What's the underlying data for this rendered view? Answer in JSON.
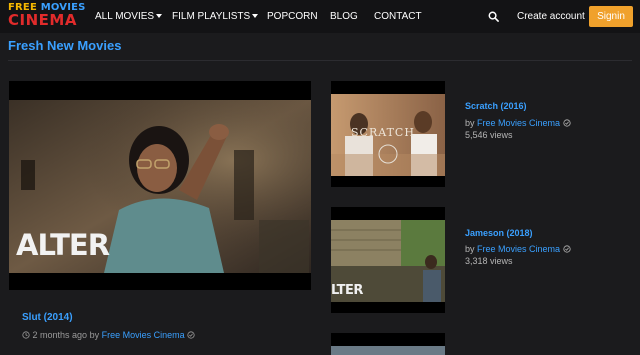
{
  "brand": {
    "logo_word1": "FREE",
    "logo_word2": "MOVIES",
    "logo_word3": "CINEMA"
  },
  "nav": {
    "items": [
      {
        "label": "ALL MOVIES",
        "dropdown": true
      },
      {
        "label": "FILM PLAYLISTS",
        "dropdown": true
      },
      {
        "label": "POPCORN",
        "dropdown": false
      },
      {
        "label": "BLOG",
        "dropdown": false
      },
      {
        "label": "CONTACT",
        "dropdown": false
      }
    ],
    "search_icon": "search-icon",
    "create_account": "Create account",
    "signin": "Signin"
  },
  "section": {
    "title": "Fresh New Movies"
  },
  "featured": {
    "overlay_text": "ALTER",
    "title": "Slut (2014)",
    "time": "2 months ago",
    "by": "by",
    "author": "Free Movies Cinema"
  },
  "side_list": [
    {
      "title": "Scratch (2016)",
      "by": "by",
      "author": "Free Movies Cinema",
      "views": "5,546 views",
      "thumb_text": "SCRATCH"
    },
    {
      "title": "Jameson (2018)",
      "by": "by",
      "author": "Free Movies Cinema",
      "views": "3,318 views",
      "thumb_text": "LTER"
    }
  ],
  "colors": {
    "accent_blue": "#3aa0ff",
    "signin_orange": "#f0a12c",
    "logo_red": "#e12b2b",
    "logo_yellow": "#f5b700",
    "background": "#1b1b1d"
  }
}
